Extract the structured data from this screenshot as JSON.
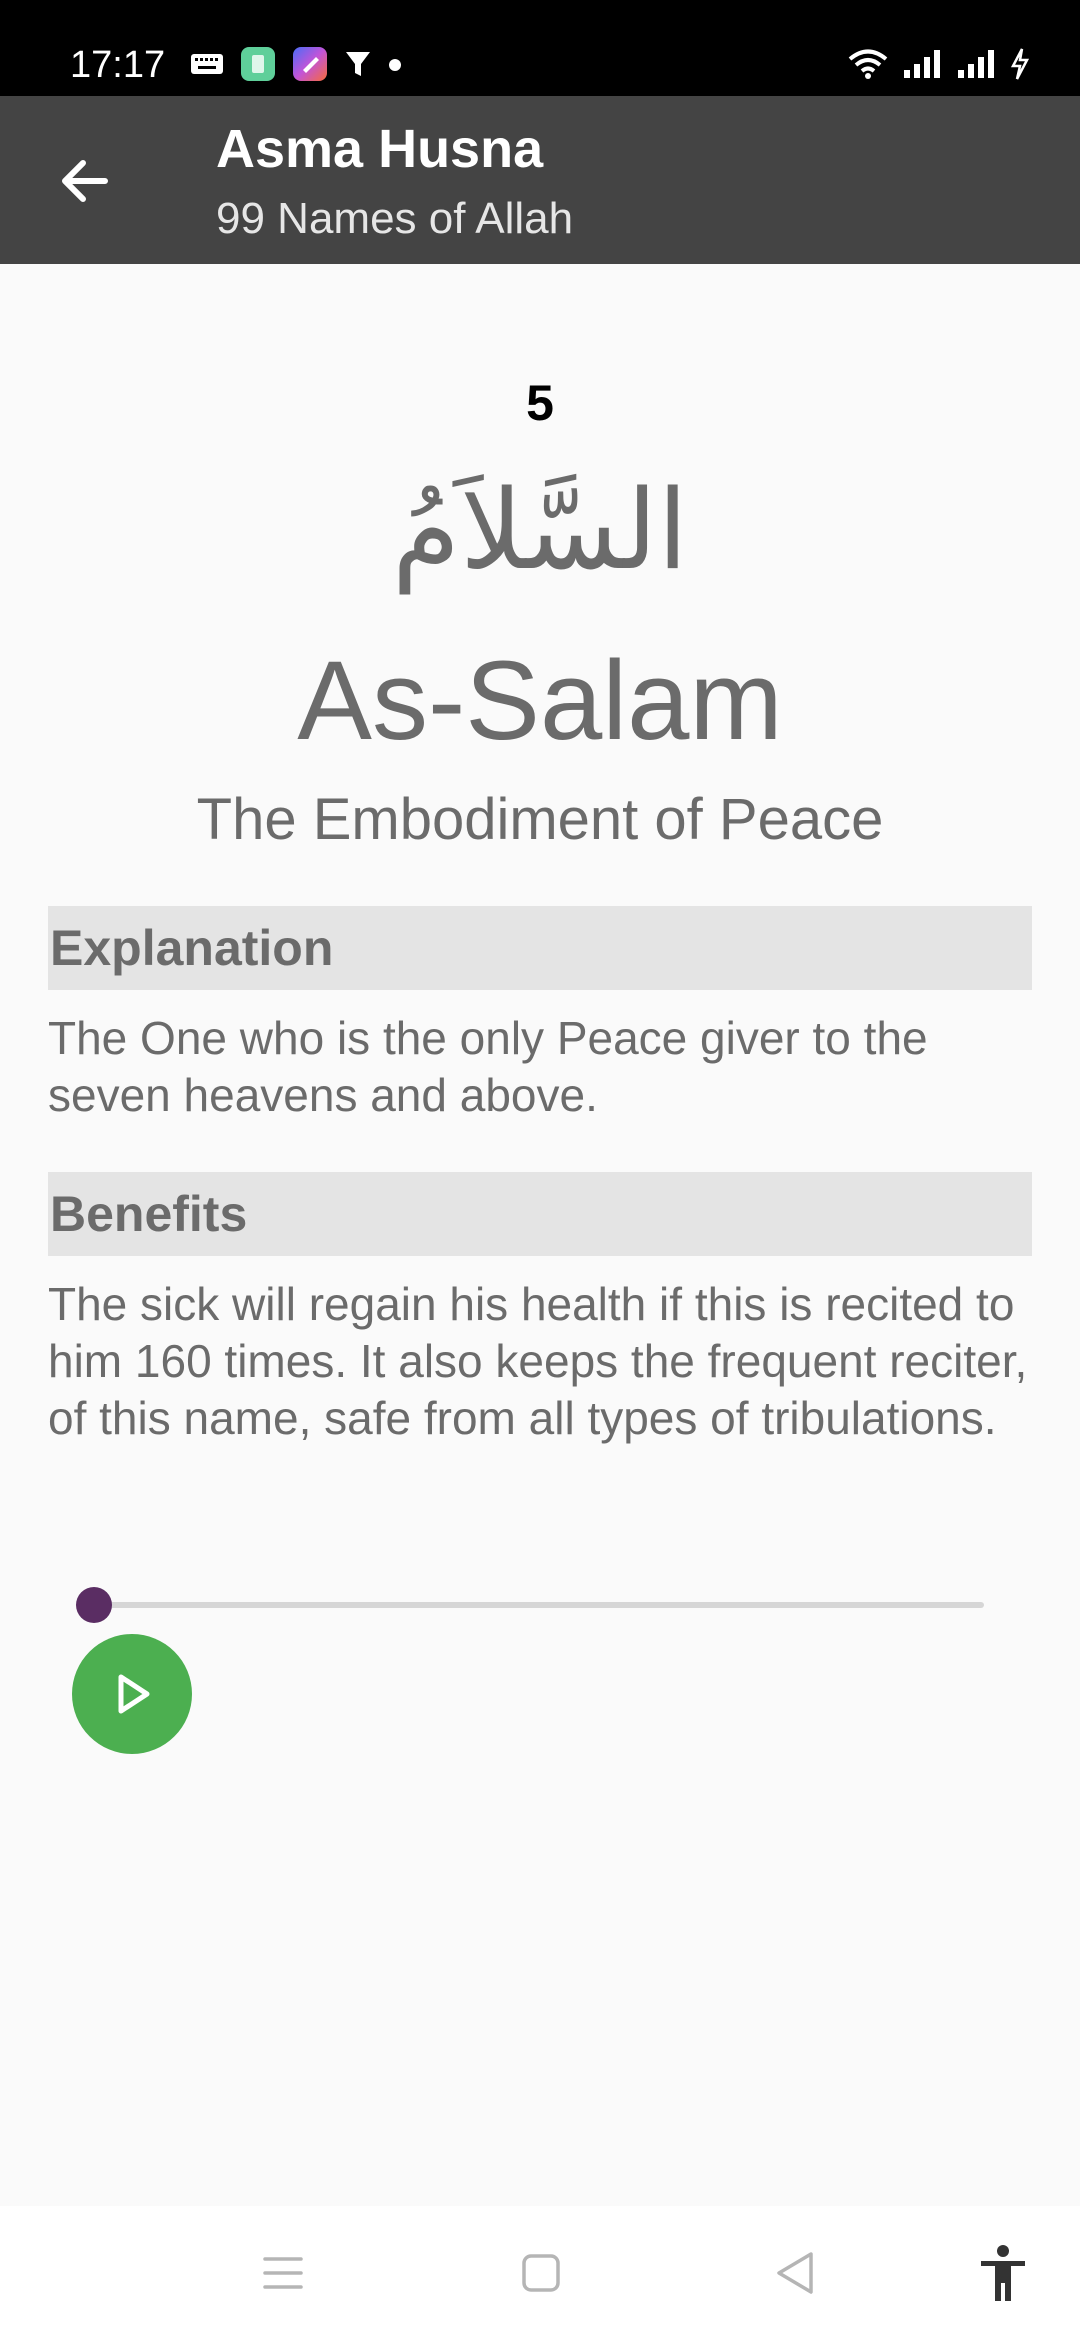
{
  "status_bar": {
    "time": "17:17",
    "left_icons": [
      "keyboard-icon",
      "app-icon-green",
      "app-icon-colorful",
      "filter-icon",
      "dot-icon"
    ],
    "right_icons": [
      "wifi-icon",
      "signal-icon",
      "signal-icon-2",
      "charging-icon"
    ]
  },
  "app_bar": {
    "title": "Asma Husna",
    "subtitle": "99 Names of Allah",
    "background_color": "#444444"
  },
  "name": {
    "number": "5",
    "arabic": "السَّلاَمُ",
    "transliteration": "As-Salam",
    "meaning": "The Embodiment of Peace"
  },
  "explanation": {
    "heading": "Explanation",
    "text": "The One who is the only Peace giver to the seven heavens and above."
  },
  "benefits": {
    "heading": "Benefits",
    "text": "The sick will regain his health if this is recited to him 160 times. It also keeps the frequent reciter, of this name, safe from all types of tribulations."
  },
  "player": {
    "progress": 0,
    "thumb_color": "#5a2d63",
    "play_color": "#4caf50"
  },
  "nav_bar": {
    "buttons": [
      "menu-icon",
      "home-icon",
      "back-triangle-icon",
      "accessibility-icon"
    ]
  }
}
